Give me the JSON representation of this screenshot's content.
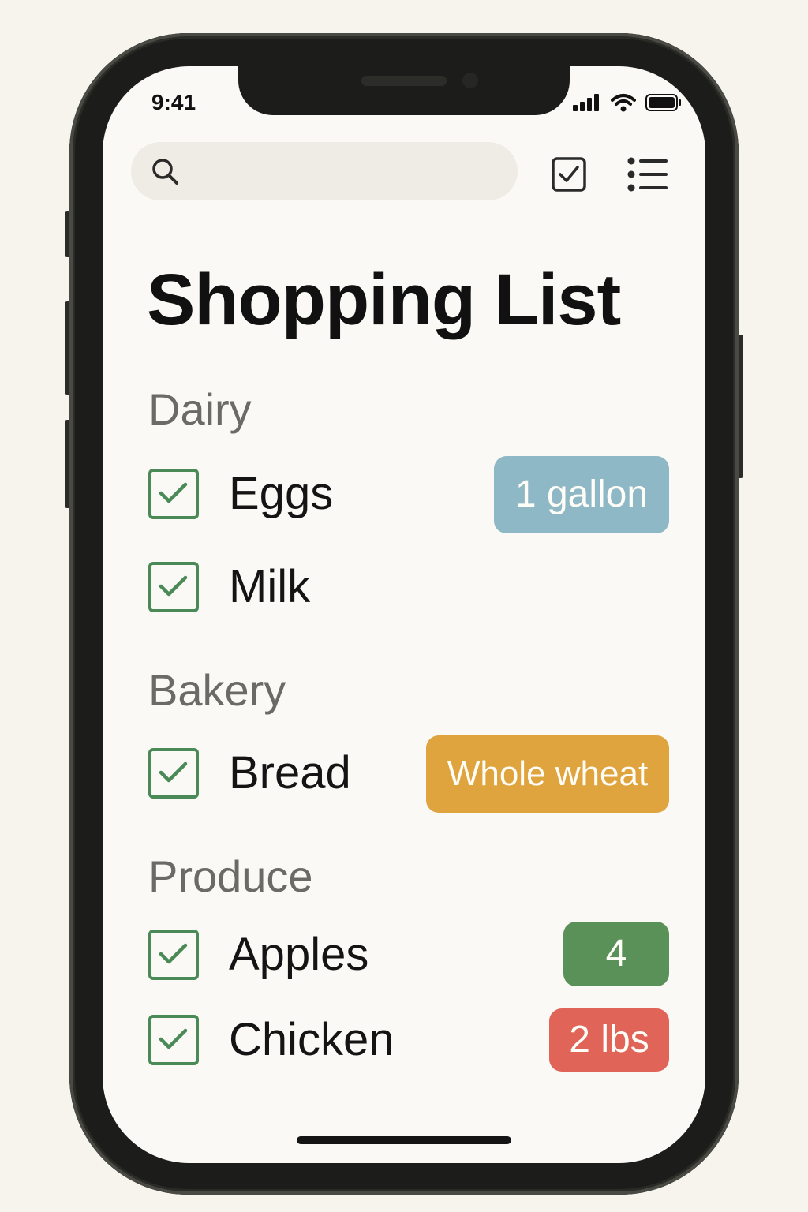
{
  "status_bar": {
    "time": "9:41"
  },
  "search": {
    "placeholder": ""
  },
  "page": {
    "title": "Shopping List"
  },
  "sections": [
    {
      "name": "Dairy",
      "items": [
        {
          "label": "Eggs",
          "checked": true,
          "badge": "1 gallon",
          "badge_color": "#8fb8c6"
        },
        {
          "label": "Milk",
          "checked": true
        }
      ]
    },
    {
      "name": "Bakery",
      "items": [
        {
          "label": "Bread",
          "checked": true,
          "badge": "Whole wheat",
          "badge_color": "#e0a43e"
        }
      ]
    },
    {
      "name": "Produce",
      "items": [
        {
          "label": "Apples",
          "checked": true,
          "badge": "4",
          "badge_color": "#5a9158"
        },
        {
          "label": "Chicken",
          "checked": true,
          "badge": "2 lbs",
          "badge_color": "#e06458"
        }
      ]
    }
  ],
  "colors": {
    "check": "#4a8a57",
    "background": "#fbf9f5"
  },
  "icons": [
    "search-icon",
    "checkbox-icon",
    "list-icon",
    "signal-icon",
    "wifi-icon",
    "battery-icon"
  ]
}
